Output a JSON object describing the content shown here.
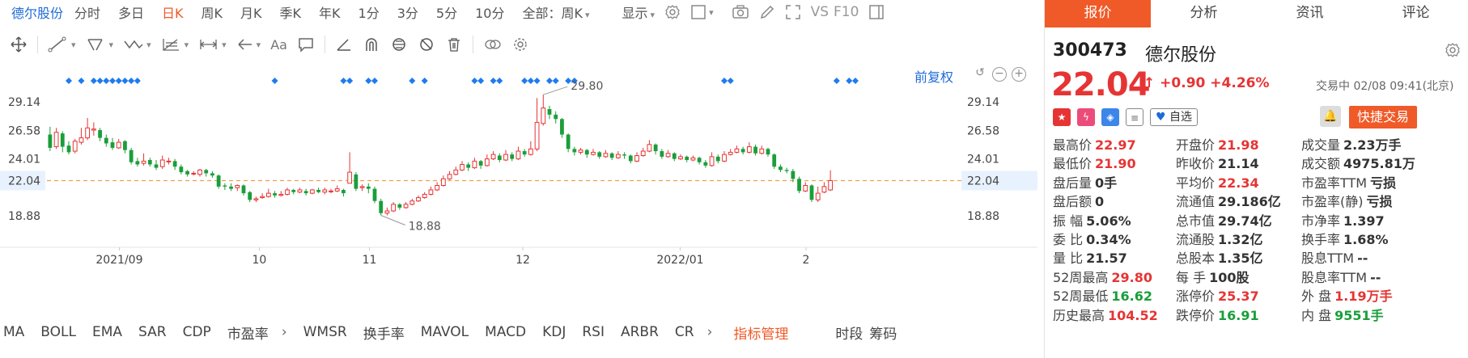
{
  "toolbar": {
    "stock_name": "德尔股份",
    "periods": [
      "分时",
      "多日",
      "日K",
      "周K",
      "月K",
      "季K",
      "年K",
      "1分",
      "3分",
      "5分",
      "10分"
    ],
    "active_period": "日K",
    "range_select": "全部：周K",
    "display_label": "显示",
    "vs_label": "VS",
    "f10_label": "F10"
  },
  "chart": {
    "fuquan_label": "前复权",
    "y_ticks": [
      "29.14",
      "26.58",
      "24.01",
      "22.04",
      "18.88"
    ],
    "x_labels": [
      "2021/09",
      "10",
      "11",
      "12",
      "2022/01",
      "2"
    ],
    "high_label": "29.80",
    "low_label": "18.88",
    "current_price_label": "22.04"
  },
  "chart_data": {
    "type": "candlestick",
    "ylim": [
      16.6,
      31.2
    ],
    "x_labels": [
      "2021/09",
      "10",
      "11",
      "12",
      "2022/01",
      "2"
    ],
    "colors": {
      "up": "#e63434",
      "down": "#1a9e3a",
      "marker": "#1e7bf0",
      "last_line": "#f0a050"
    },
    "last_price": 22.04,
    "candles": [
      [
        26.2,
        25.0,
        26.9,
        24.7
      ],
      [
        25.1,
        26.4,
        26.8,
        24.9
      ],
      [
        26.3,
        25.1,
        26.5,
        24.6
      ],
      [
        25.2,
        24.6,
        25.6,
        24.4
      ],
      [
        24.7,
        25.6,
        25.8,
        24.5
      ],
      [
        25.5,
        25.9,
        26.8,
        25.3
      ],
      [
        25.9,
        26.8,
        27.7,
        25.7
      ],
      [
        26.6,
        26.7,
        27.3,
        26.1
      ],
      [
        26.6,
        25.9,
        26.8,
        25.6
      ],
      [
        25.9,
        25.4,
        26.2,
        25.1
      ],
      [
        25.5,
        25.0,
        25.9,
        24.8
      ],
      [
        25.0,
        25.5,
        25.8,
        24.9
      ],
      [
        25.6,
        24.8,
        25.7,
        24.5
      ],
      [
        24.8,
        23.7,
        25.0,
        23.5
      ],
      [
        23.8,
        23.5,
        24.1,
        23.3
      ],
      [
        23.6,
        23.8,
        24.5,
        23.4
      ],
      [
        23.9,
        23.5,
        24.1,
        23.3
      ],
      [
        23.5,
        23.2,
        23.9,
        23.0
      ],
      [
        23.3,
        23.9,
        24.3,
        23.1
      ],
      [
        23.8,
        23.8,
        24.1,
        23.5
      ],
      [
        23.8,
        23.3,
        24.0,
        23.0
      ],
      [
        23.3,
        22.8,
        23.5,
        22.6
      ],
      [
        22.9,
        22.6,
        23.0,
        22.4
      ],
      [
        22.7,
        22.7,
        22.9,
        22.5
      ],
      [
        22.6,
        23.0,
        23.1,
        22.4
      ],
      [
        23.0,
        22.7,
        23.1,
        22.4
      ],
      [
        22.7,
        22.5,
        22.9,
        22.3
      ],
      [
        22.5,
        21.5,
        22.6,
        21.3
      ],
      [
        21.6,
        21.5,
        21.8,
        21.2
      ],
      [
        21.5,
        21.3,
        21.8,
        21.1
      ],
      [
        21.4,
        21.6,
        21.7,
        21.1
      ],
      [
        21.6,
        20.9,
        21.7,
        20.7
      ],
      [
        21.0,
        20.3,
        21.1,
        20.1
      ],
      [
        20.3,
        20.4,
        20.6,
        20.1
      ],
      [
        20.5,
        20.6,
        20.9,
        20.4
      ],
      [
        20.6,
        20.9,
        21.3,
        20.5
      ],
      [
        20.9,
        20.7,
        21.1,
        20.5
      ],
      [
        20.7,
        20.8,
        21.1,
        20.6
      ],
      [
        20.8,
        21.2,
        21.4,
        20.7
      ],
      [
        21.2,
        21.0,
        21.3,
        20.8
      ],
      [
        21.0,
        21.2,
        21.4,
        20.9
      ],
      [
        21.1,
        20.9,
        21.3,
        20.7
      ],
      [
        20.9,
        21.2,
        21.3,
        20.8
      ],
      [
        21.2,
        21.0,
        21.4,
        20.9
      ],
      [
        21.0,
        21.2,
        21.4,
        20.8
      ],
      [
        21.1,
        21.1,
        21.3,
        20.9
      ],
      [
        21.1,
        21.3,
        21.6,
        21.0
      ],
      [
        21.2,
        20.9,
        21.3,
        20.6
      ],
      [
        21.8,
        22.8,
        24.6,
        21.8
      ],
      [
        22.6,
        21.3,
        22.8,
        21.1
      ],
      [
        21.4,
        21.5,
        21.7,
        21.1
      ],
      [
        21.5,
        21.3,
        21.8,
        20.9
      ],
      [
        21.3,
        20.2,
        21.5,
        20.0
      ],
      [
        20.2,
        19.1,
        20.4,
        18.9
      ],
      [
        19.1,
        19.3,
        19.6,
        18.9
      ],
      [
        19.3,
        19.9,
        20.1,
        19.2
      ],
      [
        19.9,
        19.6,
        20.0,
        19.4
      ],
      [
        19.6,
        19.9,
        20.1,
        19.5
      ],
      [
        19.9,
        20.2,
        20.4,
        19.8
      ],
      [
        20.2,
        20.5,
        20.7,
        20.1
      ],
      [
        20.5,
        20.8,
        21.0,
        20.4
      ],
      [
        20.8,
        21.2,
        21.5,
        20.7
      ],
      [
        21.2,
        21.6,
        21.9,
        21.1
      ],
      [
        21.6,
        22.2,
        22.5,
        21.5
      ],
      [
        22.2,
        22.6,
        22.9,
        22.1
      ],
      [
        22.6,
        23.0,
        23.3,
        22.5
      ],
      [
        23.0,
        23.5,
        23.8,
        22.9
      ],
      [
        23.5,
        23.2,
        23.7,
        22.9
      ],
      [
        23.2,
        23.8,
        24.1,
        23.1
      ],
      [
        23.8,
        23.4,
        23.9,
        23.1
      ],
      [
        23.4,
        24.0,
        24.4,
        23.3
      ],
      [
        24.0,
        24.4,
        24.7,
        23.9
      ],
      [
        24.3,
        23.9,
        24.5,
        23.7
      ],
      [
        23.9,
        24.4,
        24.8,
        23.8
      ],
      [
        24.4,
        24.0,
        24.6,
        23.8
      ],
      [
        24.0,
        24.7,
        25.1,
        23.9
      ],
      [
        24.7,
        24.4,
        24.9,
        24.2
      ],
      [
        24.4,
        24.9,
        25.6,
        24.3
      ],
      [
        24.9,
        27.3,
        29.5,
        24.7
      ],
      [
        27.2,
        28.6,
        29.8,
        27.0
      ],
      [
        28.5,
        28.0,
        28.8,
        27.6
      ],
      [
        28.0,
        27.6,
        28.3,
        27.2
      ],
      [
        27.6,
        26.2,
        27.7,
        25.9
      ],
      [
        26.2,
        24.9,
        26.3,
        24.6
      ],
      [
        24.9,
        24.6,
        25.1,
        24.3
      ],
      [
        24.6,
        24.8,
        25.0,
        24.4
      ],
      [
        24.8,
        24.4,
        24.9,
        24.1
      ],
      [
        24.4,
        24.6,
        24.9,
        24.3
      ],
      [
        24.6,
        24.2,
        24.7,
        24.0
      ],
      [
        24.2,
        24.5,
        24.8,
        24.1
      ],
      [
        24.5,
        24.1,
        24.6,
        23.9
      ],
      [
        24.1,
        24.4,
        24.7,
        24.0
      ],
      [
        24.4,
        24.3,
        24.6,
        24.0
      ],
      [
        24.3,
        23.8,
        24.4,
        23.6
      ],
      [
        23.8,
        24.3,
        24.6,
        23.7
      ],
      [
        24.3,
        24.7,
        25.0,
        24.2
      ],
      [
        24.7,
        25.3,
        25.7,
        24.6
      ],
      [
        25.3,
        24.7,
        25.4,
        24.4
      ],
      [
        24.7,
        24.2,
        24.9,
        24.0
      ],
      [
        24.2,
        24.5,
        24.8,
        24.1
      ],
      [
        24.5,
        24.0,
        24.6,
        23.8
      ],
      [
        24.0,
        24.2,
        24.4,
        23.9
      ],
      [
        24.2,
        23.9,
        24.3,
        23.7
      ],
      [
        23.9,
        24.1,
        24.3,
        23.8
      ],
      [
        24.1,
        23.7,
        24.2,
        23.5
      ],
      [
        23.7,
        23.4,
        23.9,
        23.2
      ],
      [
        23.4,
        24.2,
        24.6,
        23.3
      ],
      [
        24.2,
        23.8,
        24.4,
        23.6
      ],
      [
        23.8,
        24.4,
        24.7,
        23.7
      ],
      [
        24.4,
        24.6,
        24.9,
        24.3
      ],
      [
        24.6,
        24.9,
        25.2,
        24.5
      ],
      [
        24.9,
        24.6,
        25.1,
        24.4
      ],
      [
        24.6,
        25.1,
        25.5,
        24.5
      ],
      [
        25.1,
        24.5,
        25.3,
        24.3
      ],
      [
        24.5,
        24.9,
        25.2,
        24.4
      ],
      [
        24.9,
        24.4,
        25.0,
        24.2
      ],
      [
        24.4,
        23.3,
        24.5,
        23.1
      ],
      [
        23.3,
        23.0,
        23.5,
        22.8
      ],
      [
        23.0,
        22.9,
        23.2,
        22.7
      ],
      [
        22.9,
        22.2,
        23.1,
        21.9
      ],
      [
        22.2,
        21.1,
        22.4,
        20.9
      ],
      [
        21.1,
        21.6,
        21.9,
        21.0
      ],
      [
        21.6,
        20.3,
        21.7,
        20.1
      ],
      [
        20.3,
        20.9,
        21.5,
        20.1
      ],
      [
        21.0,
        21.5,
        21.9,
        20.9
      ],
      [
        21.2,
        22.04,
        22.97,
        21.1
      ]
    ],
    "markers": [
      3,
      5,
      7,
      8,
      9,
      10,
      11,
      12,
      13,
      14,
      36,
      47,
      48,
      51,
      52,
      58,
      60,
      68,
      69,
      71,
      72,
      76,
      77,
      78,
      80,
      81,
      83,
      84,
      108,
      109,
      126,
      128,
      129
    ]
  },
  "indicators": {
    "items": [
      "MA",
      "BOLL",
      "EMA",
      "SAR",
      "CDP",
      "市盈率",
      "WMSR",
      "换手率",
      "MAVOL",
      "MACD",
      "KDJ",
      "RSI",
      "ARBR",
      "CR"
    ],
    "manage_label": "指标管理",
    "time_label": "时段",
    "chips_label": "筹码"
  },
  "quote": {
    "tabs": [
      "报价",
      "分析",
      "资讯",
      "评论"
    ],
    "active_tab": "报价",
    "code": "300473",
    "name": "德尔股份",
    "price": "22.04",
    "change": "+0.90",
    "change_pct": "+4.26%",
    "status": "交易中 02/08 09:41(北京)",
    "watch_label": "自选",
    "quick_trade_label": "快捷交易",
    "stats": [
      [
        {
          "k": "最高价",
          "v": "22.97",
          "c": "red"
        },
        {
          "k": "开盘价",
          "v": "21.98",
          "c": "red"
        },
        {
          "k": "成交量",
          "v": "2.23万手",
          "c": "dark"
        }
      ],
      [
        {
          "k": "最低价",
          "v": "21.90",
          "c": "red"
        },
        {
          "k": "昨收价",
          "v": "21.14",
          "c": "dark"
        },
        {
          "k": "成交额",
          "v": "4975.81万",
          "c": "dark"
        }
      ],
      [
        {
          "k": "盘后量",
          "v": "0手",
          "c": "dark"
        },
        {
          "k": "平均价",
          "v": "22.34",
          "c": "red"
        },
        {
          "k": "市盈率TTM",
          "v": "亏损",
          "c": "dark"
        }
      ],
      [
        {
          "k": "盘后额",
          "v": "0",
          "c": "dark"
        },
        {
          "k": "流通值",
          "v": "29.186亿",
          "c": "dark"
        },
        {
          "k": "市盈率(静)",
          "v": "亏损",
          "c": "dark"
        }
      ],
      [
        {
          "k": "振 幅",
          "v": "5.06%",
          "c": "dark"
        },
        {
          "k": "总市值",
          "v": "29.74亿",
          "c": "dark"
        },
        {
          "k": "市净率",
          "v": "1.397",
          "c": "dark"
        }
      ],
      [
        {
          "k": "委 比",
          "v": "0.34%",
          "c": "dark"
        },
        {
          "k": "流通股",
          "v": "1.32亿",
          "c": "dark"
        },
        {
          "k": "换手率",
          "v": "1.68%",
          "c": "dark"
        }
      ],
      [
        {
          "k": "量 比",
          "v": "21.57",
          "c": "dark"
        },
        {
          "k": "总股本",
          "v": "1.35亿",
          "c": "dark"
        },
        {
          "k": "股息TTM",
          "v": "--",
          "c": "dark"
        }
      ],
      [
        {
          "k": "52周最高",
          "v": "29.80",
          "c": "red"
        },
        {
          "k": "每 手",
          "v": "100股",
          "c": "dark"
        },
        {
          "k": "股息率TTM",
          "v": "--",
          "c": "dark"
        }
      ],
      [
        {
          "k": "52周最低",
          "v": "16.62",
          "c": "green"
        },
        {
          "k": "涨停价",
          "v": "25.37",
          "c": "red"
        },
        {
          "k": "外 盘",
          "v": "1.19万手",
          "c": "red"
        }
      ],
      [
        {
          "k": "历史最高",
          "v": "104.52",
          "c": "red"
        },
        {
          "k": "跌停价",
          "v": "16.91",
          "c": "green"
        },
        {
          "k": "内 盘",
          "v": "9551手",
          "c": "green"
        }
      ]
    ]
  }
}
